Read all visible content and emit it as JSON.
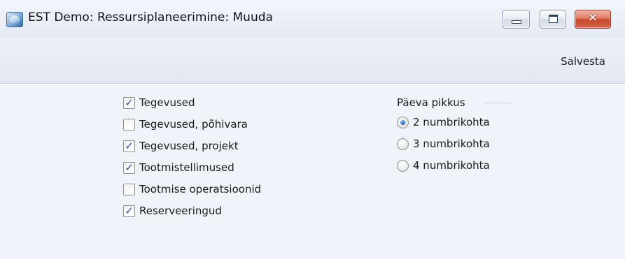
{
  "window": {
    "title": "EST Demo: Ressursiplaneerimine: Muuda",
    "icon": "app-logo-icon",
    "controls": {
      "minimize": "minimize-icon",
      "maximize": "maximize-icon",
      "close": "close-icon",
      "close_glyph": "✕"
    }
  },
  "toolbar": {
    "save_label": "Salvesta"
  },
  "options": {
    "checkboxes": [
      {
        "label": "Tegevused",
        "checked": true
      },
      {
        "label": "Tegevused, põhivara",
        "checked": false
      },
      {
        "label": "Tegevused, projekt",
        "checked": true
      },
      {
        "label": "Tootmistellimused",
        "checked": true
      },
      {
        "label": "Tootmise operatsioonid",
        "checked": false
      },
      {
        "label": "Reserveeringud",
        "checked": true
      }
    ],
    "day_length": {
      "title": "Päeva pikkus",
      "options": [
        {
          "label": "2 numbrikohta",
          "selected": true
        },
        {
          "label": "3 numbrikohta",
          "selected": false
        },
        {
          "label": "4 numbrikohta",
          "selected": false
        }
      ]
    }
  },
  "colors": {
    "titlebar": "#e4eaf3",
    "toolbar": "#e1e8f2",
    "content": "#f0f3f8",
    "check_accent": "#2b4f9a",
    "radio_accent": "#2a6fc2",
    "close_button": "#c9472b"
  }
}
